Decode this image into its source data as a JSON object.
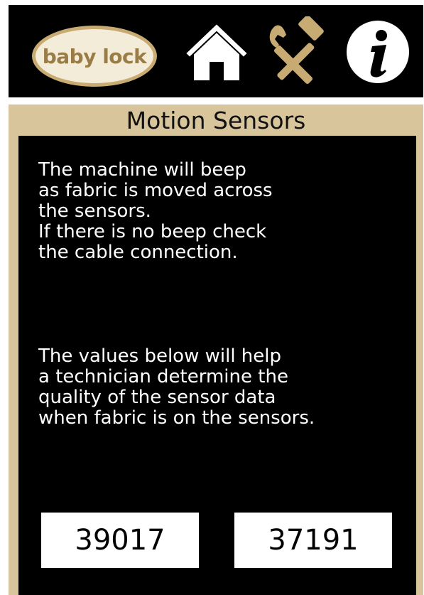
{
  "header": {
    "logo_text": "baby lock",
    "icons": [
      "home-icon",
      "tools-icon",
      "info-icon"
    ],
    "colors": {
      "background": "#000000",
      "accent": "#c8ab72",
      "icon": "#ffffff"
    }
  },
  "panel": {
    "title": "Motion Sensors",
    "message_1": "The machine will beep\nas fabric is moved across\nthe sensors.\nIf there is no beep check\nthe cable connection.",
    "message_2": "The values below will help\na technician determine the\nquality of the sensor data\nwhen fabric is on the sensors.",
    "sensor_values": [
      "39017",
      "37191"
    ],
    "colors": {
      "frame": "#d8c59c",
      "body": "#000000",
      "text": "#ffffff",
      "value_box": "#ffffff"
    }
  }
}
